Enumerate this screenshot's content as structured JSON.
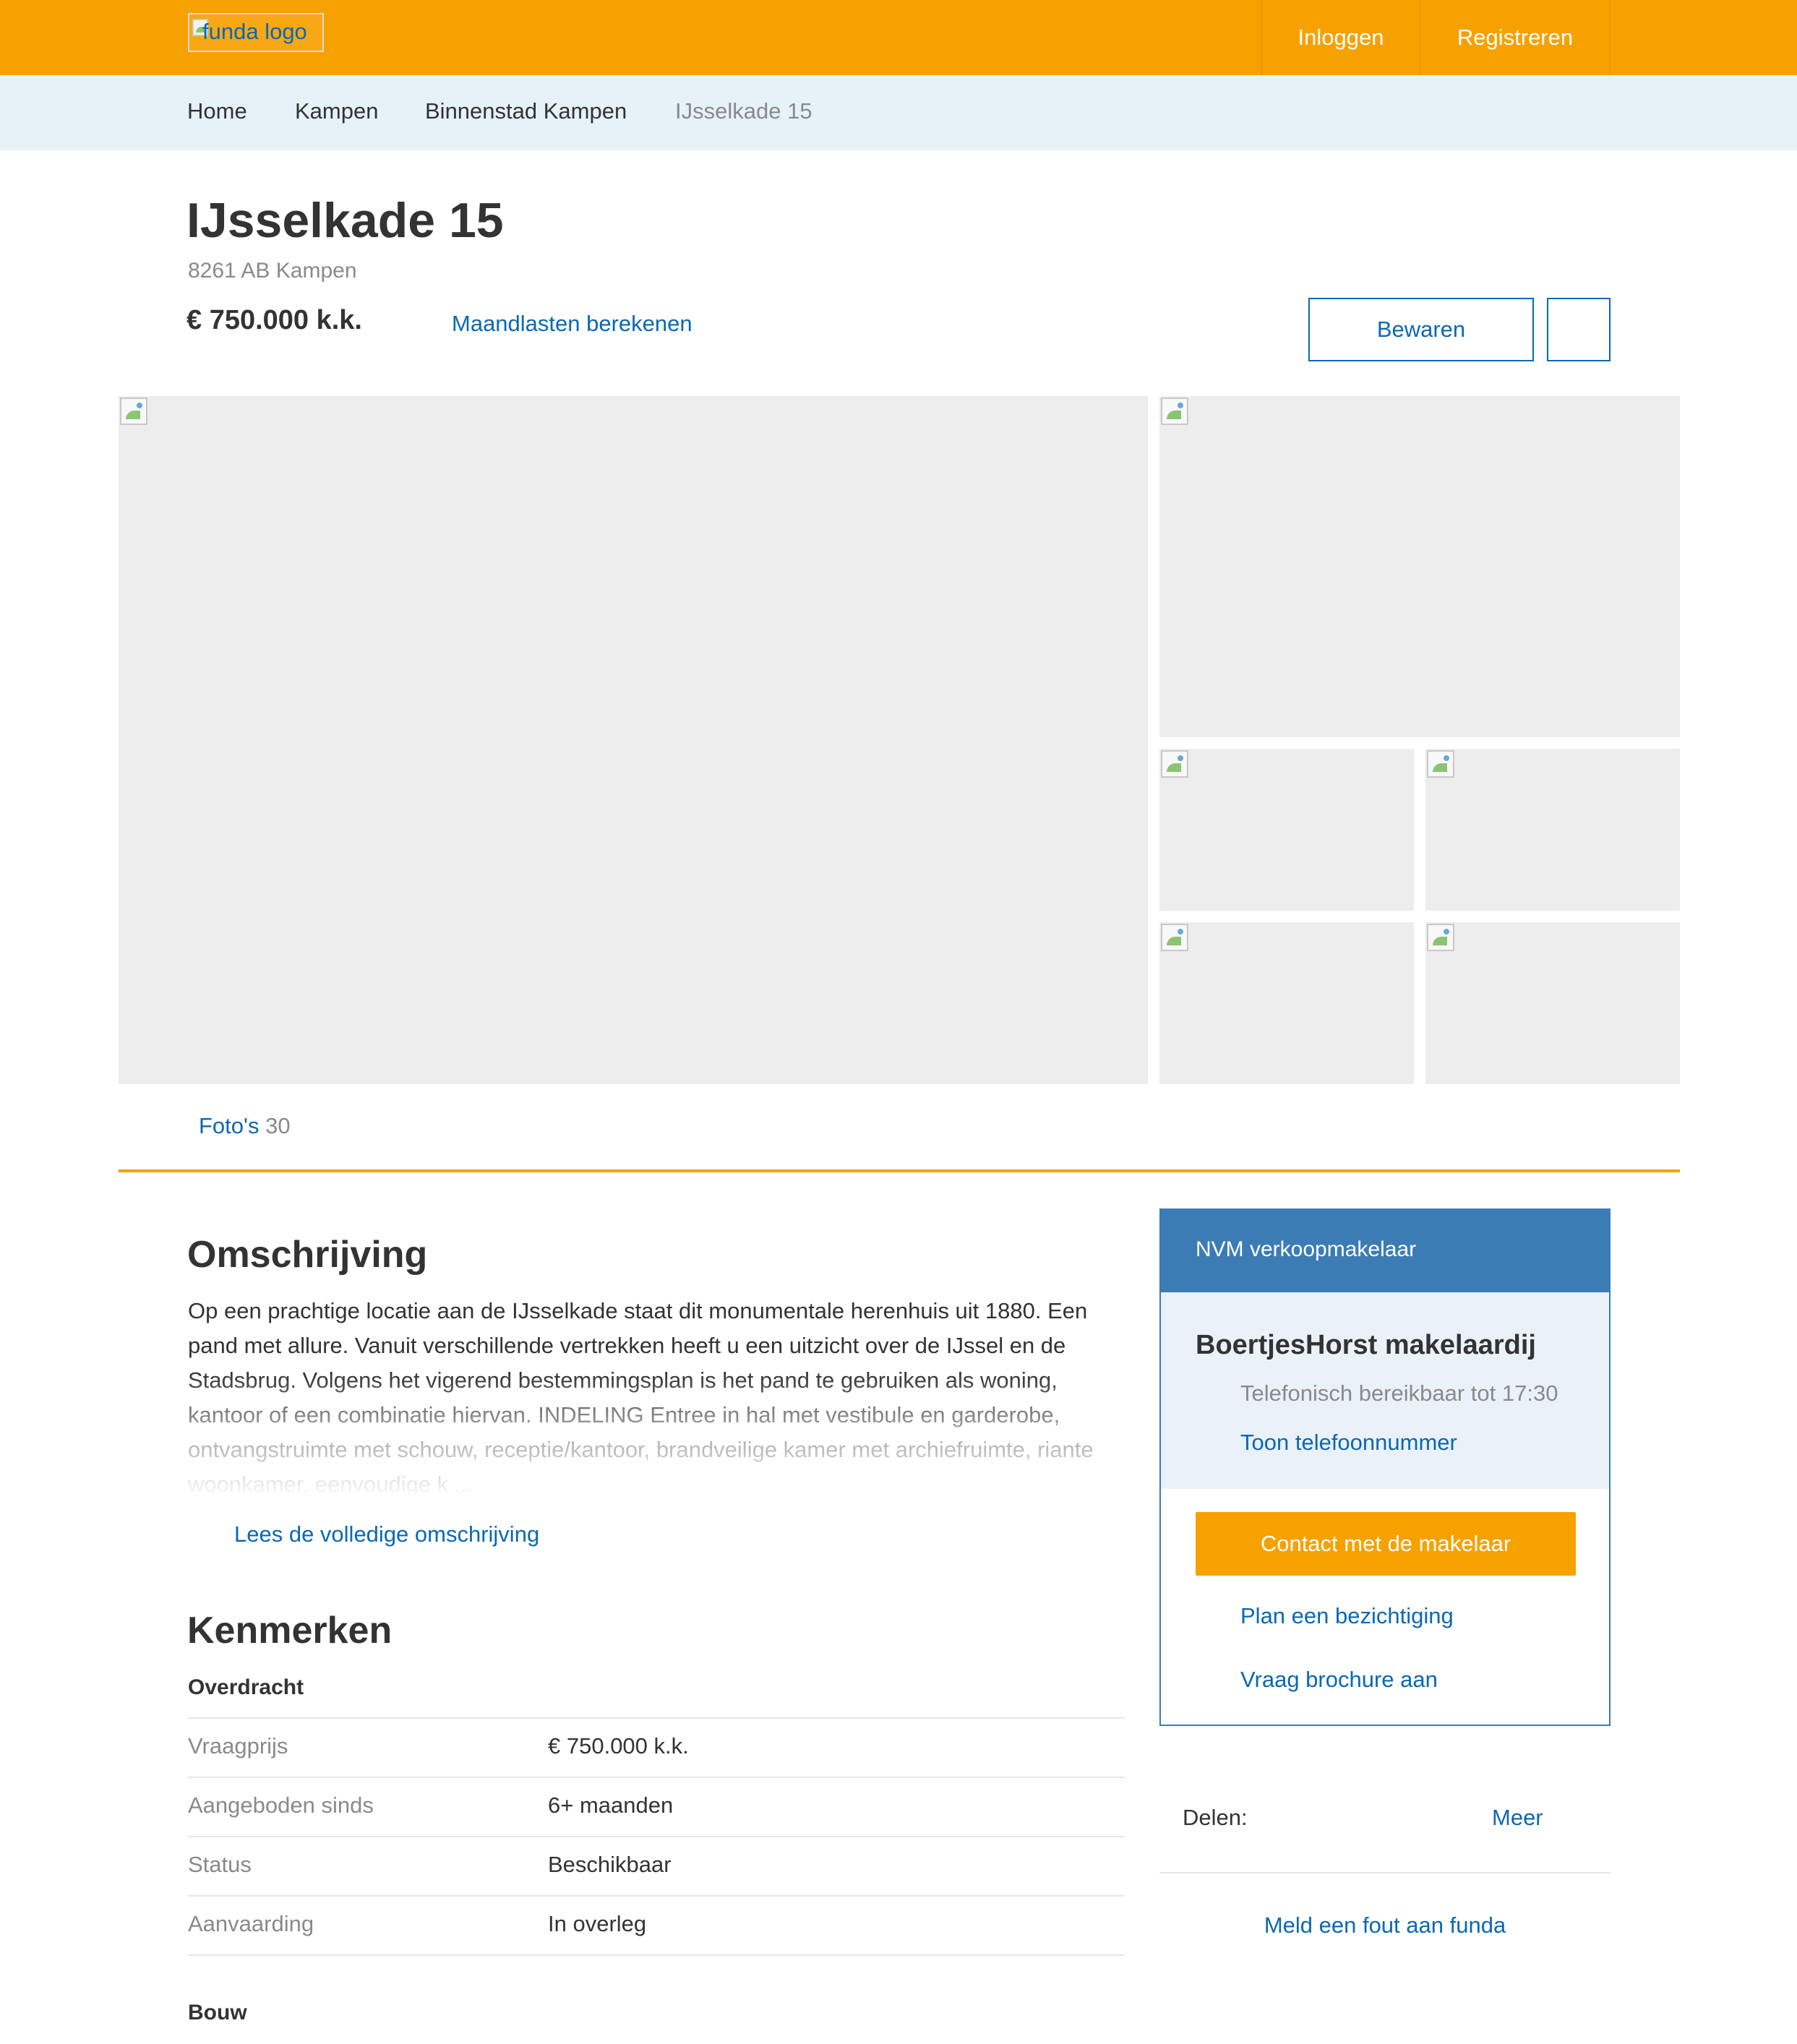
{
  "header": {
    "logo_alt": "funda logo",
    "login_label": "Inloggen",
    "register_label": "Registreren"
  },
  "breadcrumb": [
    {
      "label": "Home"
    },
    {
      "label": "Kampen"
    },
    {
      "label": "Binnenstad Kampen"
    },
    {
      "label": "IJsselkade 15"
    }
  ],
  "listing": {
    "title": "IJsselkade 15",
    "postcode_city": "8261 AB Kampen",
    "price": "€ 750.000 k.k.",
    "monthly_costs_link": "Maandlasten berekenen",
    "save_label": "Bewaren"
  },
  "photos": {
    "link_label": "Foto's",
    "count": "30"
  },
  "description": {
    "heading": "Omschrijving",
    "text": "Op een prachtige locatie aan de IJsselkade staat dit monumentale herenhuis uit 1880. Een pand met allure. Vanuit verschillende vertrekken heeft u een uitzicht over de IJssel en de Stadsbrug. Volgens het vigerend bestemmingsplan is het pand te gebruiken als woning, kantoor of een combinatie hiervan. INDELING Entree in hal met vestibule en garderobe, ontvangstruimte met schouw, receptie/kantoor, brandveilige kamer met archiefruimte, riante woonkamer, eenvoudige k ...",
    "read_more": "Lees de volledige omschrijving"
  },
  "features": {
    "heading": "Kenmerken",
    "transfer_heading": "Overdracht",
    "transfer_rows": [
      {
        "key": "Vraagprijs",
        "value": "€ 750.000 k.k."
      },
      {
        "key": "Aangeboden sinds",
        "value": "6+ maanden"
      },
      {
        "key": "Status",
        "value": "Beschikbaar"
      },
      {
        "key": "Aanvaarding",
        "value": "In overleg"
      }
    ],
    "build_heading": "Bouw"
  },
  "agent": {
    "header": "NVM verkoopmakelaar",
    "name": "BoertjesHorst makelaardij",
    "hours": "Telefonisch bereikbaar tot 17:30",
    "phone_link": "Toon telefoonnummer",
    "contact_button": "Contact met de makelaar",
    "viewing_link": "Plan een bezichtiging",
    "brochure_link": "Vraag brochure aan"
  },
  "share": {
    "label": "Delen:",
    "more": "Meer"
  },
  "report_link": "Meld een fout aan funda",
  "colors": {
    "brand_orange": "#f7a100",
    "link_blue": "#0a68b4",
    "agent_blue": "#3c7cb4",
    "breadcrumb_bg": "#e6f1f8"
  }
}
